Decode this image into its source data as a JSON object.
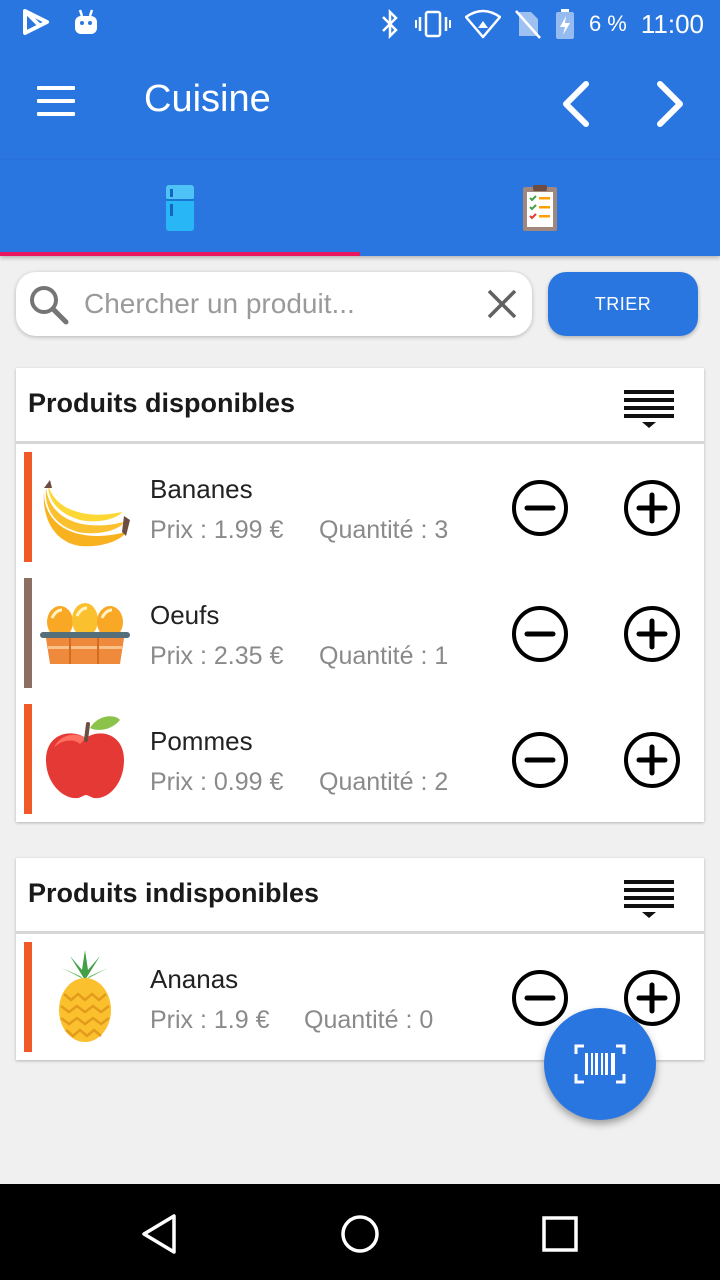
{
  "status_bar": {
    "battery_percent": "6 %",
    "time": "11:00",
    "icons": [
      "play-store-icon",
      "android-icon",
      "bluetooth-icon",
      "vibrate-icon",
      "wifi-icon",
      "no-sim-icon",
      "battery-charging-icon"
    ]
  },
  "app_bar": {
    "title": "Cuisine",
    "menu_icon": "hamburger-menu-icon",
    "prev_icon": "chevron-left-icon",
    "next_icon": "chevron-right-icon"
  },
  "tabs": [
    {
      "icon": "fridge-icon",
      "selected": true
    },
    {
      "icon": "checklist-icon",
      "selected": false
    }
  ],
  "colors": {
    "primary": "#2a76e0",
    "tab_indicator": "#e8155f",
    "accent_orange": "#f05a28",
    "accent_brown": "#8d6e63"
  },
  "search": {
    "placeholder": "Chercher un produit...",
    "value": ""
  },
  "sort_button": {
    "label": "TRIER"
  },
  "available": {
    "title": "Produits disponibles",
    "items": [
      {
        "name": "Bananes",
        "price": "Prix : 1.99 €",
        "quantity": "Quantité : 3",
        "icon": "banana-icon",
        "bar_color": "#f05a28"
      },
      {
        "name": "Oeufs",
        "price": "Prix : 2.35 €",
        "quantity": "Quantité : 1",
        "icon": "eggs-icon",
        "bar_color": "#8d6e63"
      },
      {
        "name": "Pommes",
        "price": "Prix : 0.99 €",
        "quantity": "Quantité : 2",
        "icon": "apple-icon",
        "bar_color": "#f05a28"
      }
    ]
  },
  "unavailable": {
    "title": "Produits indisponibles",
    "items": [
      {
        "name": "Ananas",
        "price": "Prix : 1.9 €",
        "quantity": "Quantité : 0",
        "icon": "pineapple-icon",
        "bar_color": "#f05a28"
      }
    ]
  },
  "fab": {
    "icon": "barcode-scan-icon"
  },
  "nav_bar": {
    "icons": [
      "back-icon",
      "home-icon",
      "recents-icon"
    ]
  }
}
